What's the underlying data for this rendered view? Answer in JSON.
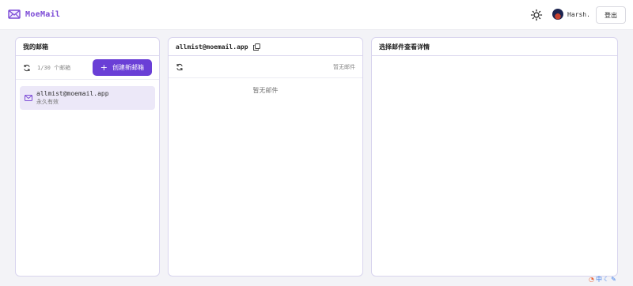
{
  "app": {
    "name": "MoeMail"
  },
  "header": {
    "user_name": "Harsh.",
    "logout_label": "登出"
  },
  "mailbox_panel": {
    "title": "我的邮箱",
    "count_text": "1/30 个邮箱",
    "create_label": "创建新邮箱",
    "items": [
      {
        "address": "allmist@moemail.app",
        "expiry": "永久有效"
      }
    ]
  },
  "inbox_panel": {
    "title": "allmist@moemail.app",
    "status_text": "暂无邮件",
    "empty_text": "暂无邮件"
  },
  "detail_panel": {
    "title": "选择邮件查看详情"
  },
  "tray": {
    "ime_label": "中"
  },
  "colors": {
    "accent": "#6a3fd6",
    "brand": "#7c4bd6",
    "border": "#d9d5ee",
    "selected_bg": "#ece8f8"
  }
}
